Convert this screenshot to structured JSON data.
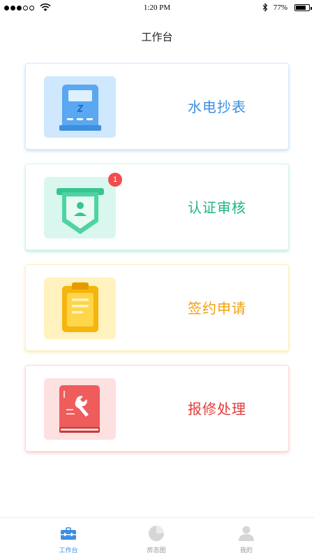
{
  "status_bar": {
    "time": "1:20 PM",
    "battery_percent": "77%",
    "battery_level": 0.77,
    "signal_dots_filled": 3,
    "signal_dots_total": 5
  },
  "header": {
    "title": "工作台"
  },
  "cards": [
    {
      "label": "水电抄表",
      "icon": "meter-icon",
      "color": "#3b8fe0"
    },
    {
      "label": "认证审核",
      "icon": "id-badge-icon",
      "color": "#1fb580",
      "badge": "1"
    },
    {
      "label": "签约申请",
      "icon": "clipboard-icon",
      "color": "#f0a010"
    },
    {
      "label": "报修处理",
      "icon": "wrench-book-icon",
      "color": "#e23a3a"
    }
  ],
  "tabbar": {
    "tabs": [
      {
        "label": "工作台",
        "icon": "toolbox-icon",
        "active": true
      },
      {
        "label": "房态图",
        "icon": "pie-chart-icon",
        "active": false
      },
      {
        "label": "我的",
        "icon": "user-icon",
        "active": false
      }
    ]
  }
}
